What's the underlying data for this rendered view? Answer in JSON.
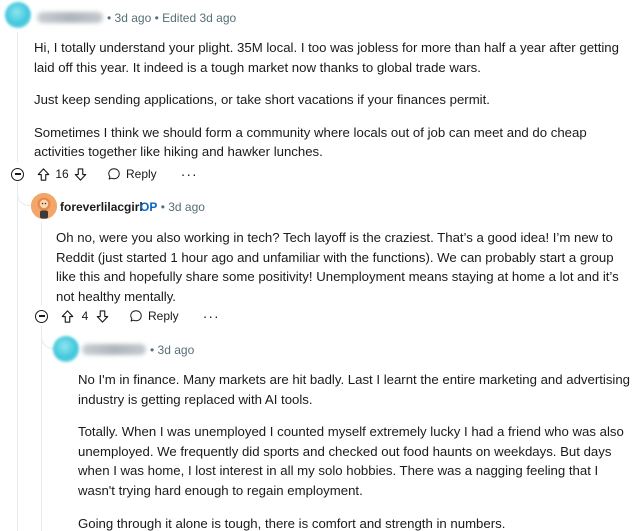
{
  "comments": [
    {
      "meta": "• 3d ago • Edited 3d ago",
      "paragraphs": [
        "Hi, I totally understand your plight. 35M local. I too was jobless for more than half a year after getting laid off this year. It indeed is a tough market now thanks to global trade wars.",
        "Just keep sending applications, or take short vacations if your finances permit.",
        "Sometimes I think we should form a community where locals out of job can meet and do cheap activities together like hiking and hawker lunches."
      ],
      "score": "16",
      "reply_label": "Reply",
      "more_label": "···"
    },
    {
      "username": "foreverlilacgirl",
      "op_badge": "OP",
      "meta": "• 3d ago",
      "paragraphs": [
        "Oh no, were you also working in tech? Tech layoff is the craziest. That’s a good idea! I’m new to Reddit (just started 1 hour ago and unfamiliar with the functions). We can probably start a group like this and hopefully share some positivity! Unemployment means staying at home a lot and it’s not healthy mentally."
      ],
      "score": "4",
      "reply_label": "Reply",
      "more_label": "···"
    },
    {
      "meta": "• 3d ago",
      "paragraphs": [
        "No I'm in finance. Many markets are hit badly. Last I learnt the entire marketing and advertising industry is getting replaced with AI tools.",
        "Totally. When I was unemployed I counted myself extremely lucky I had a friend who was also unemployed. We frequently did sports and checked out food haunts on weekdays. But days when I was home, I lost interest in all my solo hobbies. There was a nagging feeling that I wasn't trying hard enough to regain employment.",
        "Going through it alone is tough, there is comfort and strength in numbers."
      ]
    }
  ],
  "icons": {
    "collapse": "collapse-icon",
    "upvote": "upvote-icon",
    "downvote": "downvote-icon",
    "reply": "reply-icon",
    "more": "more-icon"
  },
  "colors": {
    "meta_text": "#576f76",
    "op_badge": "#0a66c2",
    "thread_line": "#e5ebee"
  }
}
